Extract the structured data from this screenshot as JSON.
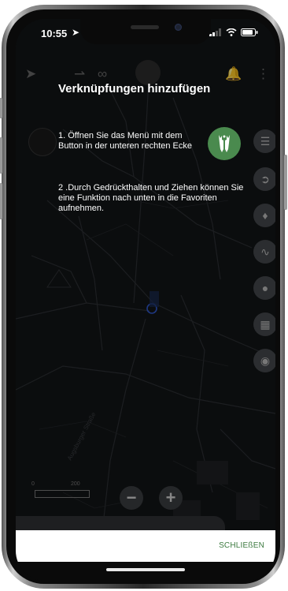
{
  "statusbar": {
    "time": "10:55"
  },
  "dialog": {
    "title": "Verknüpfungen hinzufügen",
    "step1": "1. Öffnen Sie das Menü mit dem Button in der unteren rechten Ecke",
    "step2": "2 .Durch Gedrückthalten und Ziehen können Sie eine Funktion nach unten in die Favoriten aufnehmen."
  },
  "map": {
    "street_label": "Augsburger Straße",
    "scale_labels": [
      "0",
      "200"
    ]
  },
  "footer": {
    "close_label": "SCHLIEßEN"
  },
  "colors": {
    "accent_green": "#4a8a4e",
    "close_text": "#3c7a3f",
    "map_background": "#121416",
    "location_dot": "#2f57c9"
  },
  "icons": [
    "location-arrow-icon",
    "share-icon",
    "route-icon",
    "menu-logo-icon",
    "bell-icon",
    "more-vertical-icon",
    "compass-icon",
    "layers-icon",
    "pin-icon",
    "dog-icon",
    "track-icon",
    "person-icon",
    "map-icon",
    "hunting-spot-icon",
    "zoom-out-icon",
    "zoom-in-icon"
  ]
}
